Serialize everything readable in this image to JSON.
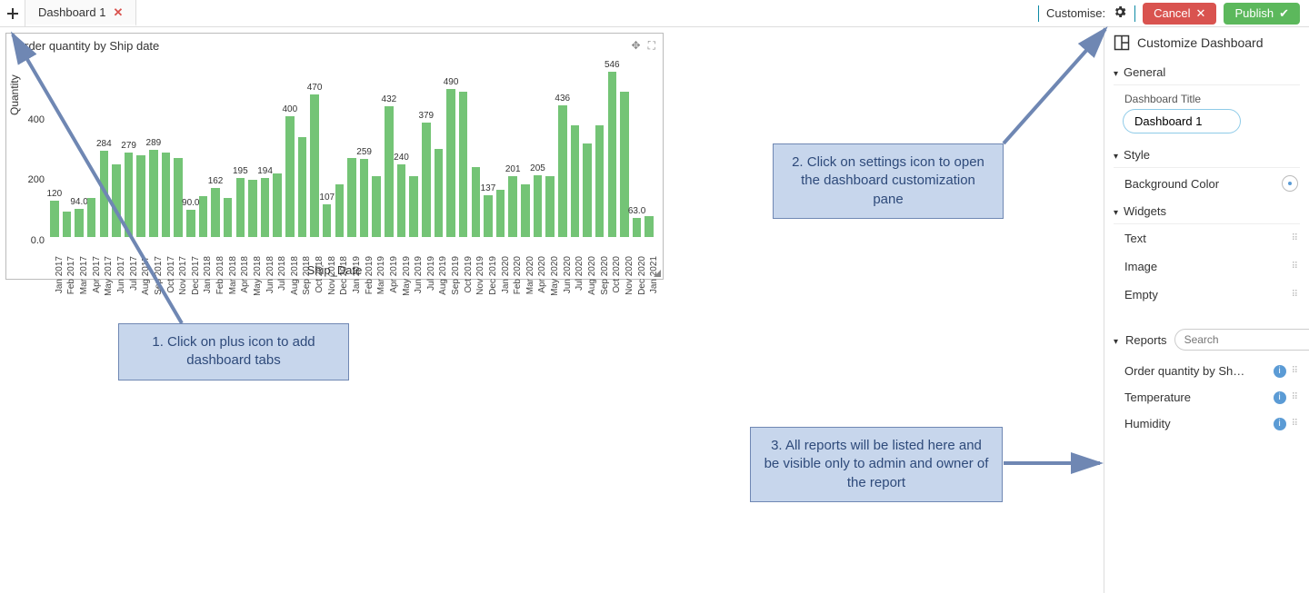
{
  "topbar": {
    "tab_label": "Dashboard 1",
    "customise_label": "Customise:",
    "cancel_label": "Cancel",
    "publish_label": "Publish"
  },
  "sidepanel": {
    "header": "Customize Dashboard",
    "sections": {
      "general": {
        "title": "General",
        "title_field_label": "Dashboard Title",
        "title_value": "Dashboard 1"
      },
      "style": {
        "title": "Style",
        "bg_label": "Background Color"
      },
      "widgets": {
        "title": "Widgets",
        "items": [
          "Text",
          "Image",
          "Empty"
        ]
      },
      "reports": {
        "title": "Reports",
        "search_placeholder": "Search",
        "items": [
          "Order quantity by Sh…",
          "Temperature",
          "Humidity"
        ]
      }
    }
  },
  "card": {
    "title": "Order quantity by Ship date",
    "ylabel": "Quantity",
    "xlabel": "Ship_Date"
  },
  "callouts": {
    "c1": "1. Click on plus icon to add dashboard tabs",
    "c2": "2. Click on settings icon to open the dashboard customization pane",
    "c3": "3. All reports will be listed here and be visible only to admin and owner of the report"
  },
  "chart_data": {
    "type": "bar",
    "title": "Order quantity by Ship date",
    "xlabel": "Ship_Date",
    "ylabel": "Quantity",
    "ylim": [
      0,
      600
    ],
    "yticks": [
      0,
      200,
      400
    ],
    "categories": [
      "Jan 2017",
      "Feb 2017",
      "Mar 2017",
      "Apr 2017",
      "May 2017",
      "Jun 2017",
      "Jul 2017",
      "Aug 2017",
      "Sep 2017",
      "Oct 2017",
      "Nov 2017",
      "Dec 2017",
      "Jan 2018",
      "Feb 2018",
      "Mar 2018",
      "Apr 2018",
      "May 2018",
      "Jun 2018",
      "Jul 2018",
      "Aug 2018",
      "Sep 2018",
      "Oct 2018",
      "Nov 2018",
      "Dec 2018",
      "Jan 2019",
      "Feb 2019",
      "Mar 2019",
      "Apr 2019",
      "May 2019",
      "Jun 2019",
      "Jul 2019",
      "Aug 2019",
      "Sep 2019",
      "Oct 2019",
      "Nov 2019",
      "Dec 2019",
      "Jan 2020",
      "Feb 2020",
      "Mar 2020",
      "Apr 2020",
      "May 2020",
      "Jun 2020",
      "Jul 2020",
      "Aug 2020",
      "Sep 2020",
      "Oct 2020",
      "Nov 2020",
      "Dec 2020",
      "Jan 2021"
    ],
    "values": [
      120,
      85,
      94,
      130,
      284,
      240,
      279,
      270,
      289,
      280,
      260,
      90,
      135,
      162,
      130,
      195,
      190,
      194,
      210,
      400,
      330,
      470,
      107,
      175,
      260,
      259,
      200,
      432,
      240,
      200,
      379,
      290,
      490,
      480,
      230,
      137,
      155,
      201,
      175,
      205,
      200,
      436,
      370,
      310,
      370,
      546,
      480,
      63,
      70
    ],
    "data_labels": {
      "0": "120",
      "2": "94.0",
      "4": "284",
      "6": "279",
      "8": "289",
      "11": "90.0",
      "13": "162",
      "15": "195",
      "17": "194",
      "19": "400",
      "21": "470",
      "22": "107",
      "25": "259",
      "27": "432",
      "28": "240",
      "30": "379",
      "32": "490",
      "35": "137",
      "37": "201",
      "39": "205",
      "41": "436",
      "45": "546",
      "47": "63.0"
    }
  }
}
